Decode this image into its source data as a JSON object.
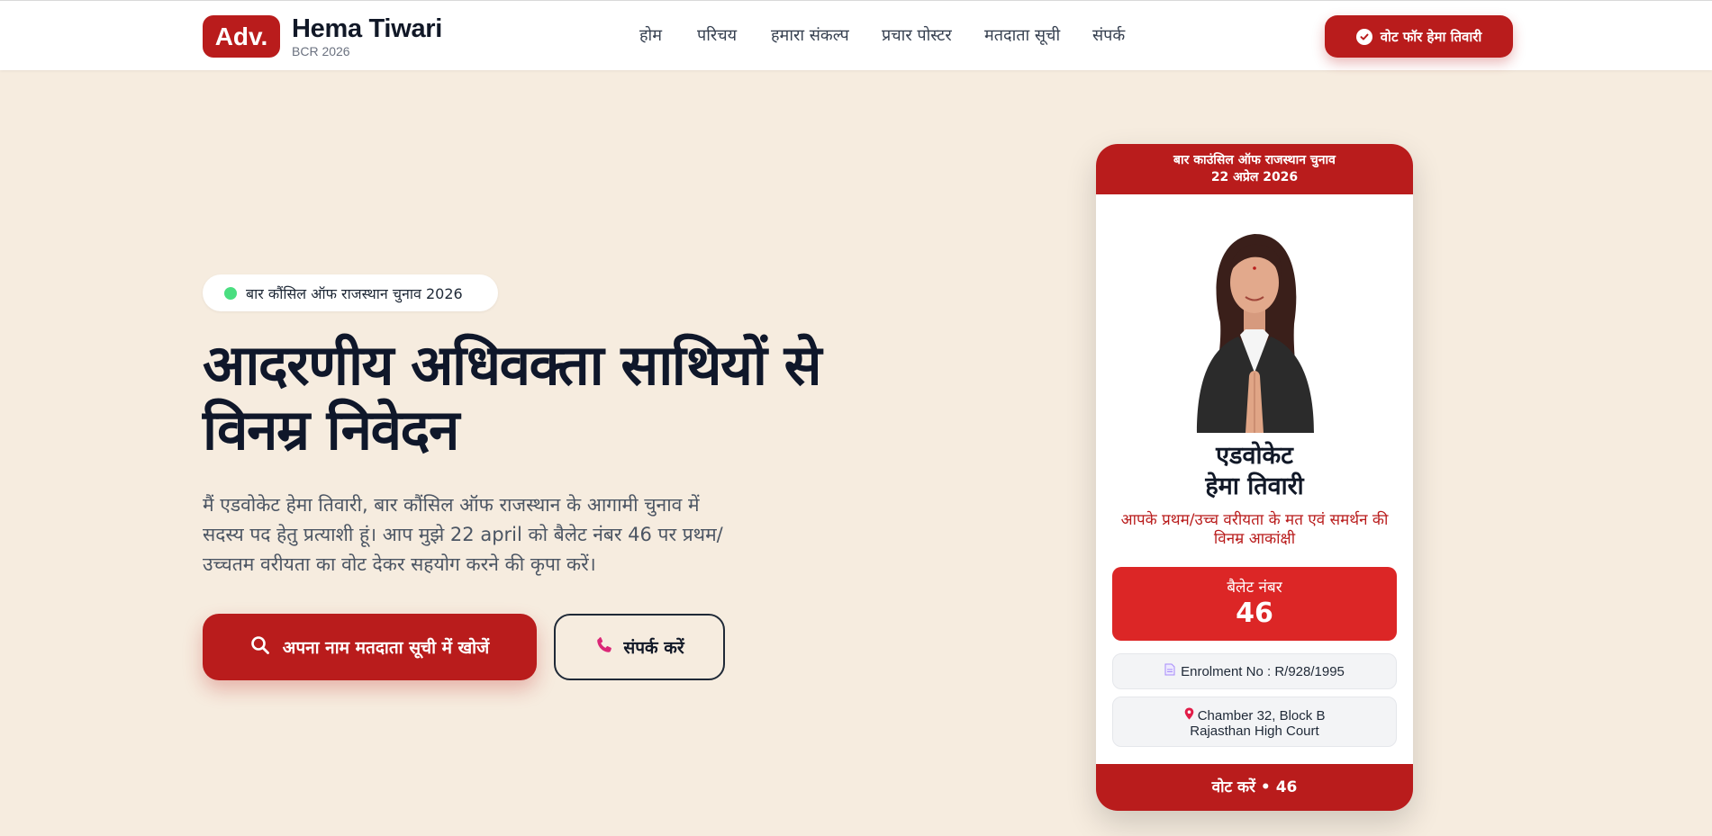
{
  "header": {
    "logo_text": "Adv.",
    "brand_name": "Hema Tiwari",
    "brand_sub": "BCR 2026",
    "nav": [
      {
        "label": "होम"
      },
      {
        "label": "परिचय"
      },
      {
        "label": "हमारा संकल्प"
      },
      {
        "label": "प्रचार पोस्टर"
      },
      {
        "label": "मतदाता सूची"
      },
      {
        "label": "संपर्क"
      }
    ],
    "vote_button": "वोट फॉर हेमा तिवारी"
  },
  "hero": {
    "badge": "बार कौंसिल ऑफ राजस्थान चुनाव 2026",
    "title_line1": "आदरणीय अधिवक्ता साथियों से",
    "title_line2": "विनम्र निवेदन",
    "desc_line1": "मैं एडवोकेट हेमा तिवारी, बार कौंसिल ऑफ राजस्थान के आगामी चुनाव में",
    "desc_line2": "सदस्य पद हेतु प्रत्याशी हूं। आप मुझे 22 april को बैलेट नंबर 46 पर प्रथम/",
    "desc_line3": "उच्चतम वरीयता का वोट देकर सहयोग करने की कृपा करें।",
    "search_button": "अपना नाम मतदाता सूची में खोजें",
    "contact_button": "संपर्क करें"
  },
  "card": {
    "top_line1": "बार काउंसिल ऑफ राजस्थान चुनाव",
    "top_line2": "22 अप्रेल 2026",
    "role": "एडवोकेट",
    "name": "हेमा तिवारी",
    "appeal_line1": "आपके प्रथम/उच्च वरीयता के मत एवं समर्थन की",
    "appeal_line2": "विनम्र आकांक्षी",
    "ballot_label": "बैलेट नंबर",
    "ballot_number": "46",
    "enrolment": "Enrolment No : R/928/1995",
    "address_line1": "Chamber 32, Block B",
    "address_line2": "Rajasthan High Court",
    "bottom": "वोट करें • 46"
  },
  "colors": {
    "brand_red": "#b91c1c",
    "ballot_red": "#dc2626",
    "page_bg": "#f6ecdf",
    "status_green": "#4ade80"
  },
  "icons": [
    "check-circle-icon",
    "search-icon",
    "phone-icon",
    "document-icon",
    "location-pin-icon"
  ]
}
